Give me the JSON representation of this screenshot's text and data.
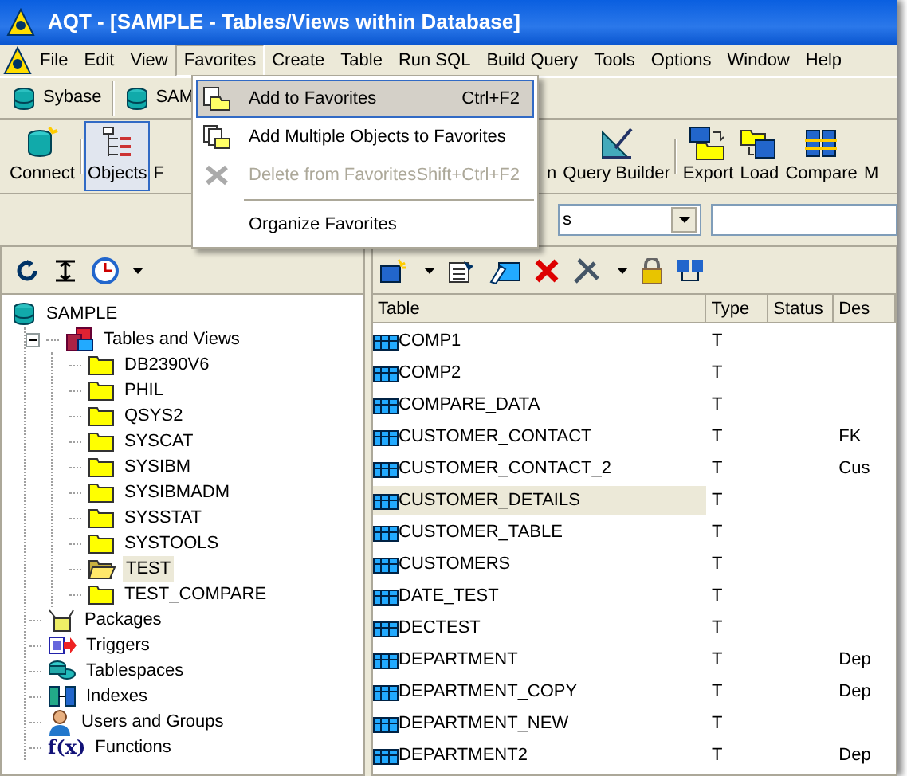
{
  "window": {
    "title": "AQT - [SAMPLE - Tables/Views within Database]"
  },
  "menu_bar": [
    {
      "label": "File",
      "selected": false
    },
    {
      "label": "Edit",
      "selected": false
    },
    {
      "label": "View",
      "selected": false
    },
    {
      "label": "Favorites",
      "selected": true
    },
    {
      "label": "Create",
      "selected": false
    },
    {
      "label": "Table",
      "selected": false
    },
    {
      "label": "Run SQL",
      "selected": false
    },
    {
      "label": "Build Query",
      "selected": false
    },
    {
      "label": "Tools",
      "selected": false
    },
    {
      "label": "Options",
      "selected": false
    },
    {
      "label": "Window",
      "selected": false
    },
    {
      "label": "Help",
      "selected": false
    }
  ],
  "favorites_menu": {
    "items": [
      {
        "kind": "item",
        "label": "Add to Favorites",
        "shortcut": "Ctrl+F2",
        "highlighted": true,
        "disabled": false
      },
      {
        "kind": "item",
        "label": "Add Multiple Objects to Favorites",
        "highlighted": false,
        "disabled": false
      },
      {
        "kind": "item",
        "label": "Delete from Favorites",
        "shortcut": "Shift+Ctrl+F2",
        "highlighted": false,
        "disabled": true
      },
      {
        "kind": "separator"
      },
      {
        "kind": "item",
        "label": "Organize Favorites",
        "highlighted": false,
        "disabled": false
      }
    ]
  },
  "connection_toolbar": [
    {
      "label": "Sybase"
    },
    {
      "label": "SAM"
    }
  ],
  "main_toolbar_left": [
    {
      "label": "Connect",
      "kind": "connect",
      "selected": false
    },
    {
      "label": "Objects",
      "kind": "objects",
      "selected": true
    },
    {
      "label": "F",
      "kind": "text",
      "selected": false
    }
  ],
  "main_toolbar_right": [
    {
      "label": "n",
      "kind": "text",
      "selected": false
    },
    {
      "label": "Query Builder",
      "kind": "builder",
      "selected": false
    },
    {
      "label": "Export",
      "kind": "export",
      "selected": false
    },
    {
      "label": "Load",
      "kind": "load",
      "selected": false
    },
    {
      "label": "Compare",
      "kind": "compare",
      "selected": false
    },
    {
      "label": "M",
      "kind": "text",
      "selected": false
    }
  ],
  "filter_bar": {
    "combo_value": "s"
  },
  "tree": {
    "items": [
      {
        "label": "SAMPLE",
        "kind": "database",
        "children": [
          {
            "label": "Tables and Views",
            "kind": "tables",
            "expanded": true,
            "children": [
              {
                "label": "DB2390V6",
                "kind": "folder",
                "selected": false
              },
              {
                "label": "PHIL",
                "kind": "folder",
                "selected": false
              },
              {
                "label": "QSYS2",
                "kind": "folder",
                "selected": false
              },
              {
                "label": "SYSCAT",
                "kind": "folder",
                "selected": false
              },
              {
                "label": "SYSIBM",
                "kind": "folder",
                "selected": false
              },
              {
                "label": "SYSIBMADM",
                "kind": "folder",
                "selected": false
              },
              {
                "label": "SYSSTAT",
                "kind": "folder",
                "selected": false
              },
              {
                "label": "SYSTOOLS",
                "kind": "folder",
                "selected": false
              },
              {
                "label": "TEST",
                "kind": "folder",
                "selected": true
              },
              {
                "label": "TEST_COMPARE",
                "kind": "folder",
                "selected": false
              }
            ]
          },
          {
            "label": "Packages",
            "kind": "packages"
          },
          {
            "label": "Triggers",
            "kind": "triggers"
          },
          {
            "label": "Tablespaces",
            "kind": "tablespaces"
          },
          {
            "label": "Indexes",
            "kind": "indexes"
          },
          {
            "label": "Users and Groups",
            "kind": "users"
          },
          {
            "label": "Functions",
            "kind": "functions",
            "icon_text": "f(x)"
          }
        ]
      }
    ]
  },
  "object_list": {
    "columns": [
      "Table",
      "Type",
      "Status",
      "Des"
    ],
    "rows": [
      {
        "cells": [
          "COMP1",
          "T",
          "",
          ""
        ],
        "selected": false
      },
      {
        "cells": [
          "COMP2",
          "T",
          "",
          ""
        ],
        "selected": false
      },
      {
        "cells": [
          "COMPARE_DATA",
          "T",
          "",
          ""
        ],
        "selected": false
      },
      {
        "cells": [
          "CUSTOMER_CONTACT",
          "T",
          "",
          "FK"
        ],
        "selected": false
      },
      {
        "cells": [
          "CUSTOMER_CONTACT_2",
          "T",
          "",
          "Cus"
        ],
        "selected": false
      },
      {
        "cells": [
          "CUSTOMER_DETAILS",
          "T",
          "",
          ""
        ],
        "selected": true
      },
      {
        "cells": [
          "CUSTOMER_TABLE",
          "T",
          "",
          ""
        ],
        "selected": false
      },
      {
        "cells": [
          "CUSTOMERS",
          "T",
          "",
          ""
        ],
        "selected": false
      },
      {
        "cells": [
          "DATE_TEST",
          "T",
          "",
          ""
        ],
        "selected": false
      },
      {
        "cells": [
          "DECTEST",
          "T",
          "",
          ""
        ],
        "selected": false
      },
      {
        "cells": [
          "DEPARTMENT",
          "T",
          "",
          "Dep"
        ],
        "selected": false
      },
      {
        "cells": [
          "DEPARTMENT_COPY",
          "T",
          "",
          "Dep"
        ],
        "selected": false
      },
      {
        "cells": [
          "DEPARTMENT_NEW",
          "T",
          "",
          ""
        ],
        "selected": false
      },
      {
        "cells": [
          "DEPARTMENT2",
          "T",
          "",
          "Dep"
        ],
        "selected": false
      }
    ]
  }
}
